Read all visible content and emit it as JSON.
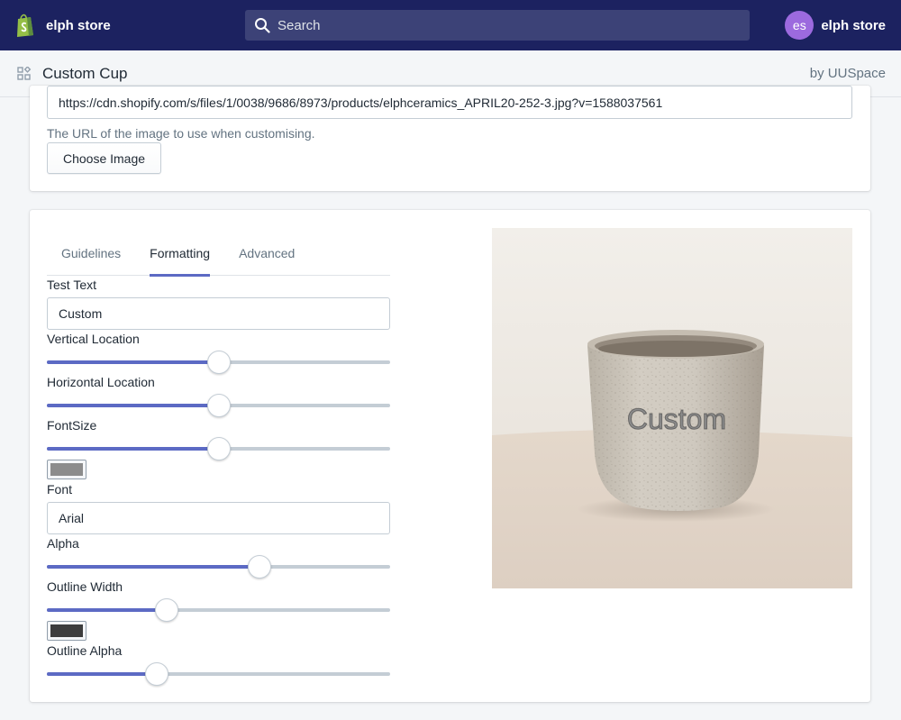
{
  "topbar": {
    "store_name": "elph store",
    "search_placeholder": "Search",
    "avatar_initials": "es",
    "account_name": "elph store"
  },
  "app_header": {
    "title": "Custom Cup",
    "by": "by UUSpace"
  },
  "image_card": {
    "url_value": "https://cdn.shopify.com/s/files/1/0038/9686/8973/products/elphceramics_APRIL20-252-3.jpg?v=1588037561",
    "help_text": "The URL of the image to use when customising.",
    "choose_button": "Choose Image"
  },
  "tabs": [
    {
      "label": "Guidelines",
      "active": false
    },
    {
      "label": "Formatting",
      "active": true
    },
    {
      "label": "Advanced",
      "active": false
    }
  ],
  "formatting": {
    "test_text_label": "Test Text",
    "test_text_value": "Custom",
    "vertical_label": "Vertical Location",
    "vertical_value": 0.5,
    "horizontal_label": "Horizontal Location",
    "horizontal_value": 0.5,
    "fontsize_label": "FontSize",
    "fontsize_value": 0.5,
    "font_color": "#8c8c8c",
    "font_label": "Font",
    "font_value": "Arial",
    "alpha_label": "Alpha",
    "alpha_value": 0.62,
    "outline_width_label": "Outline Width",
    "outline_width_value": 0.35,
    "outline_color": "#3d3d3d",
    "outline_alpha_label": "Outline Alpha",
    "outline_alpha_value": 0.32
  },
  "preview": {
    "overlay_text": "Custom"
  },
  "colors": {
    "topbar": "#1c2260",
    "accent": "#5c6ac4",
    "avatar": "#9c6ade"
  }
}
